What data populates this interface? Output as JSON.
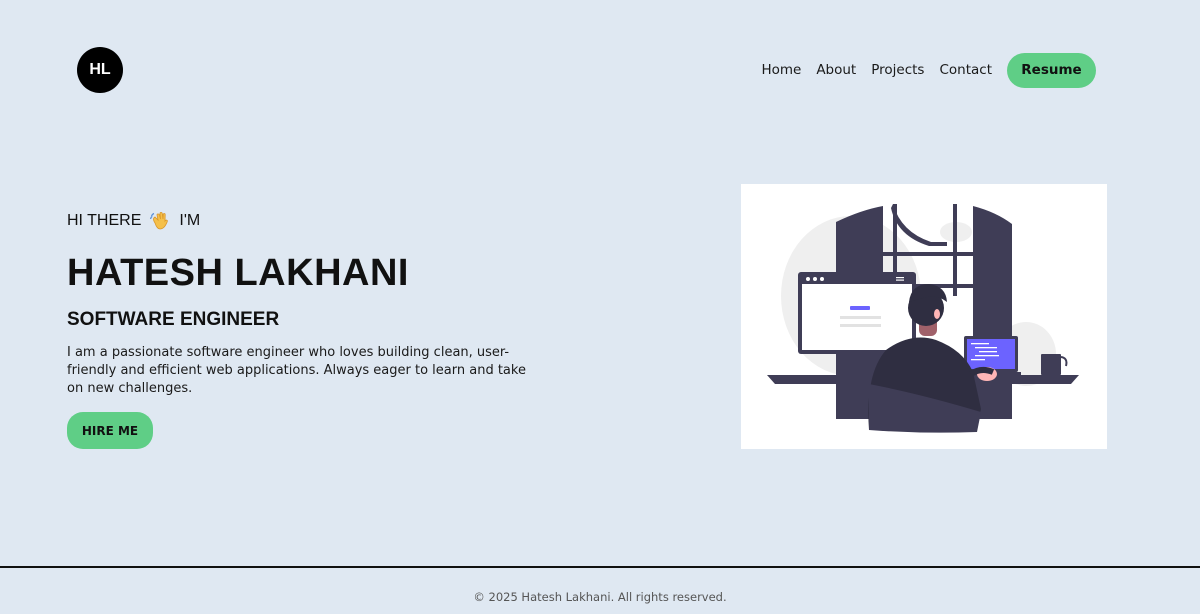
{
  "logo": {
    "initials": "HL"
  },
  "nav": {
    "links": [
      "Home",
      "About",
      "Projects",
      "Contact"
    ],
    "resume_label": "Resume"
  },
  "hero": {
    "greeting_before": "HI THERE",
    "greeting_icon": "waving-hand-icon",
    "greeting_after": "I'M",
    "name": "HATESH LAKHANI",
    "role": "SOFTWARE ENGINEER",
    "bio": "I am a passionate software engineer who loves building clean, user-friendly and efficient web applications. Always eager to learn and take on new challenges.",
    "hire_label": "HIRE ME"
  },
  "footer": {
    "text": "© 2025 Hatesh Lakhani. All rights reserved."
  },
  "colors": {
    "background": "#dfe8f2",
    "accent": "#5fce86",
    "dark": "#3f3d56",
    "screen_accent": "#6c63ff"
  }
}
